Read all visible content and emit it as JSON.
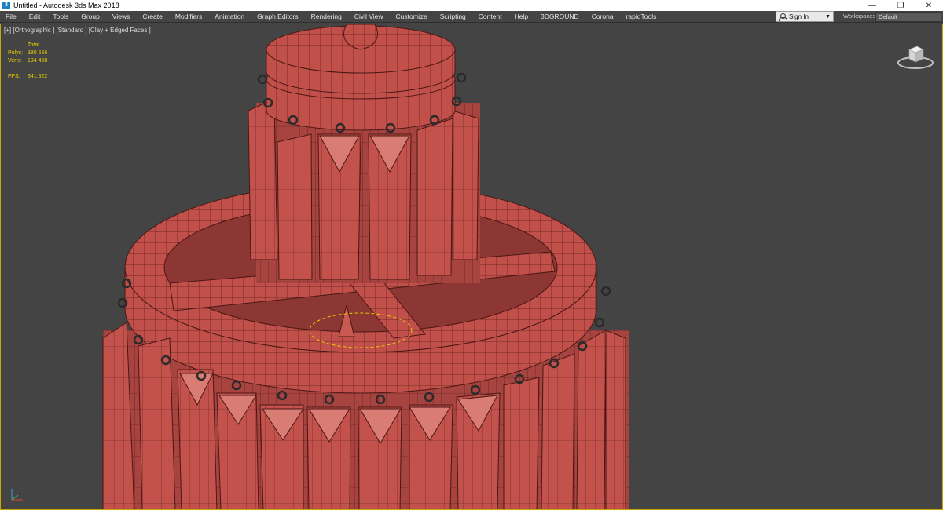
{
  "window": {
    "title": "Untitled - Autodesk 3ds Max 2018",
    "minimize": "—",
    "maximize": "❐",
    "close": "✕"
  },
  "menu": [
    "File",
    "Edit",
    "Tools",
    "Group",
    "Views",
    "Create",
    "Modifiers",
    "Animation",
    "Graph Editors",
    "Rendering",
    "Civil View",
    "Customize",
    "Scripting",
    "Content",
    "Help",
    "3DGROUND",
    "Corona",
    "rapidTools"
  ],
  "signin": {
    "label": "Sign In"
  },
  "workspaces": {
    "label": "Workspaces:",
    "value": "Default"
  },
  "viewport": {
    "label": "[+] [Orthographic ] [Standard ] [Clay + Edged Faces ]",
    "stats": {
      "total_label": "Total",
      "polys_label": "Polys:",
      "polys": "380 556",
      "verts_label": "Verts:",
      "verts": "194 468",
      "fps_label": "FPS:",
      "fps": "341,822"
    }
  },
  "colors": {
    "accent": "#c8a800",
    "model": "#c2504a",
    "background": "#444444"
  }
}
